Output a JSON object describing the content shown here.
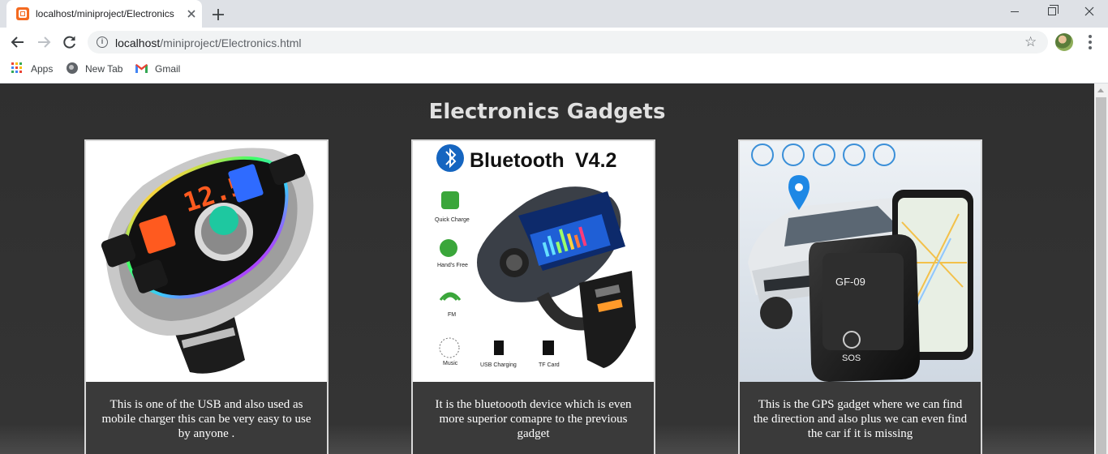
{
  "browser": {
    "tab": {
      "title": "localhost/miniproject/Electronics",
      "favicon": "xampp-icon",
      "close": "close-icon"
    },
    "new_tab": "plus-icon",
    "window_controls": [
      "minimize-icon",
      "restore-icon",
      "close-icon"
    ],
    "address": {
      "host": "localhost",
      "path": "/miniproject/Electronics.html",
      "info": "i"
    },
    "star_glyph": "☆",
    "bookmarks": [
      {
        "label": "Apps",
        "icon": "apps-grid-icon"
      },
      {
        "label": "New Tab",
        "icon": "globe-icon"
      },
      {
        "label": "Gmail",
        "icon": "gmail-icon"
      }
    ]
  },
  "page": {
    "title": "Electronics Gadgets",
    "background": "#333333",
    "cards": [
      {
        "image": "car-usb-charger-image",
        "description": "This is one of the USB and also used as mobile charger this can be very easy to use by anyone ."
      },
      {
        "image": "bluetooth-fm-transmitter-image",
        "image_text": {
          "heading": "Bluetooth",
          "version": "V4.2",
          "features": [
            "Quick Charge",
            "Hand's Free",
            "FM",
            "Music",
            "USB Charging",
            "TF Card"
          ]
        },
        "description": "It is the bluetoooth device which is even more superior comapre to the previous gadget"
      },
      {
        "image": "gps-tracker-image",
        "image_text": {
          "device_label": "GF-09",
          "sos_label": "SOS"
        },
        "description": "This is the GPS gadget where we can find the direction and also plus we can even find the car if it is missing"
      }
    ]
  }
}
